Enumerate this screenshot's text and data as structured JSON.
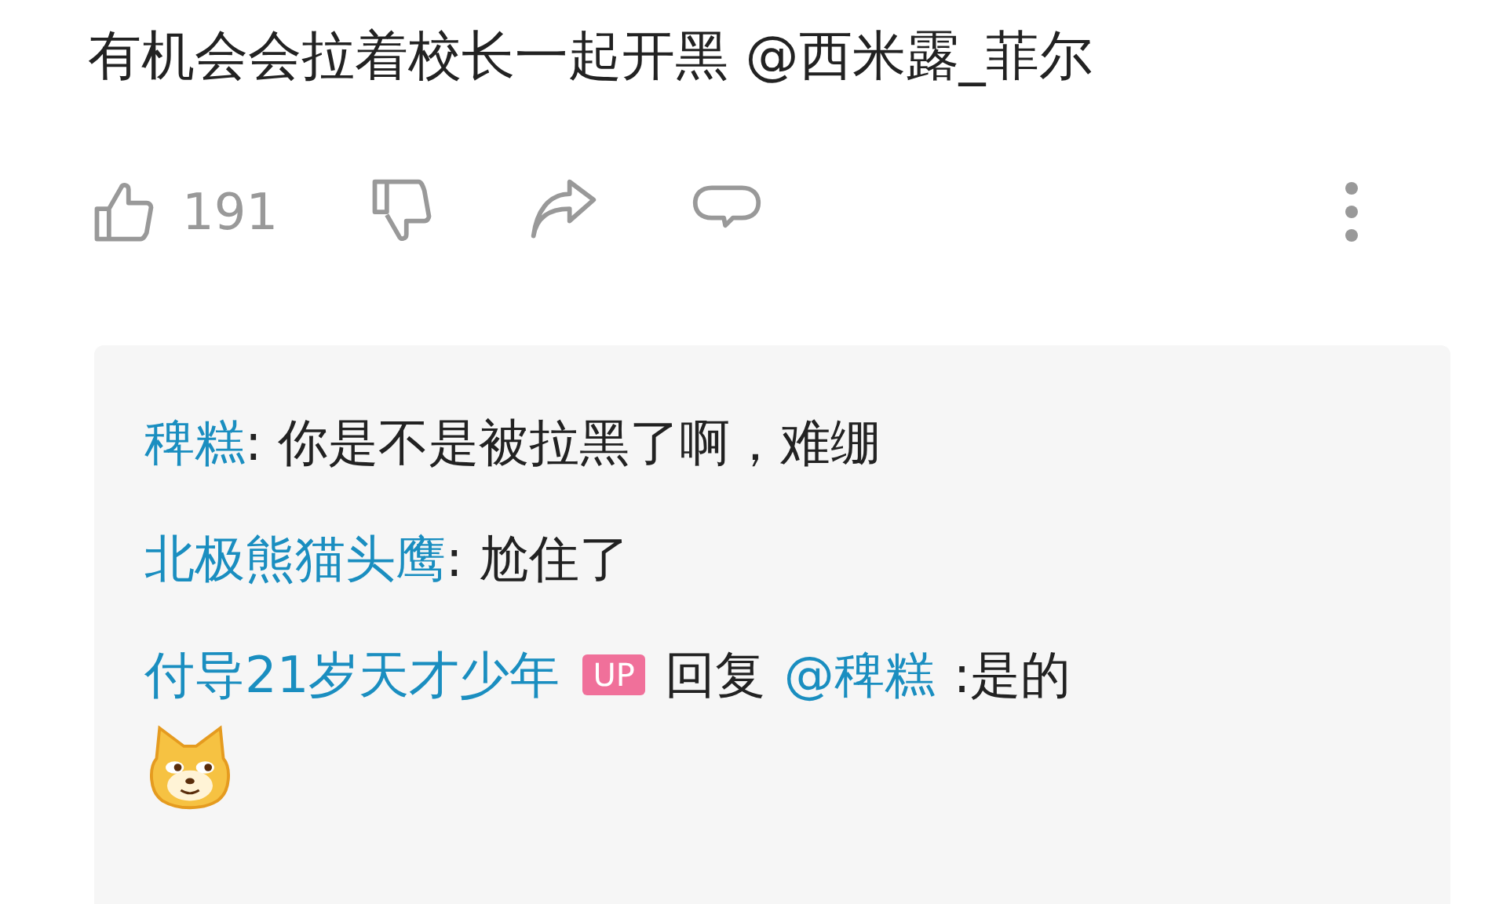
{
  "comment": {
    "text": "有机会会拉着校长一起开黑 @西米露_菲尔"
  },
  "actions": {
    "like_count": "191"
  },
  "replies": [
    {
      "user": "稗糕",
      "text": ": 你是不是被拉黑了啊，难绷"
    },
    {
      "user": "北极熊猫头鹰",
      "text": ": 尬住了"
    },
    {
      "user": "付导21岁天才少年",
      "badge": "UP",
      "reply_word": "回复",
      "mention": "@稗糕",
      "text": ":是的",
      "sticker": true
    }
  ]
}
